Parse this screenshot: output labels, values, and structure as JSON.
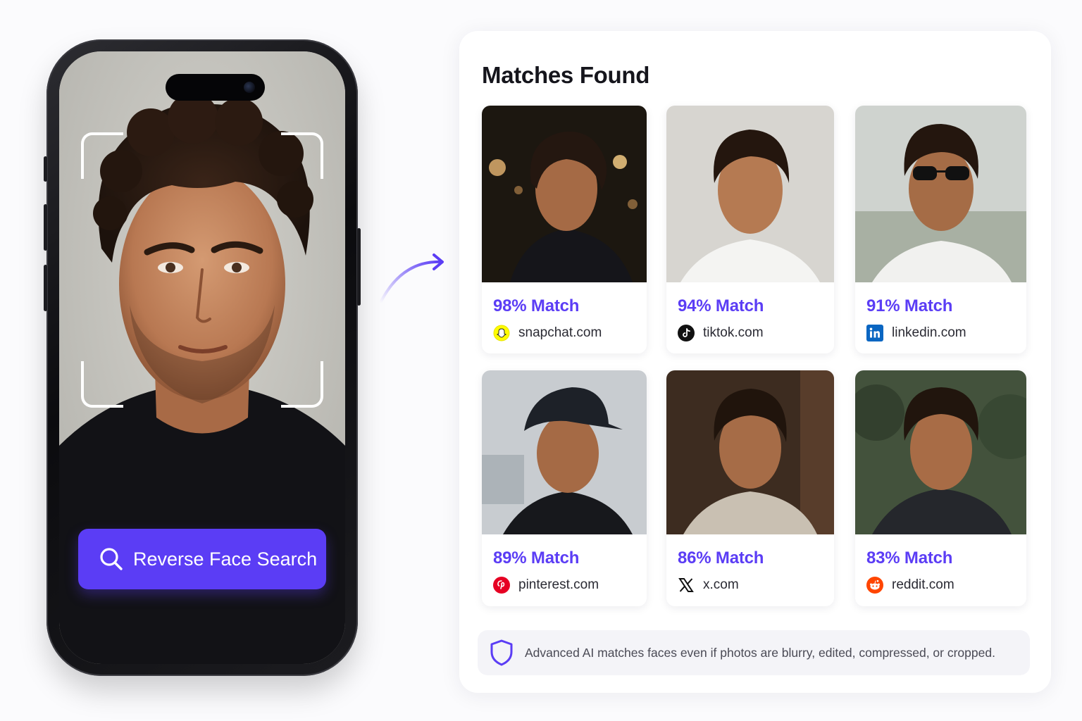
{
  "phone": {
    "search_button_label": "Reverse Face Search"
  },
  "results": {
    "title": "Matches Found",
    "matches": [
      {
        "percent": "98% Match",
        "domain": "snapchat.com",
        "icon": "snapchat-icon"
      },
      {
        "percent": "94% Match",
        "domain": "tiktok.com",
        "icon": "tiktok-icon"
      },
      {
        "percent": "91% Match",
        "domain": "linkedin.com",
        "icon": "linkedin-icon"
      },
      {
        "percent": "89% Match",
        "domain": "pinterest.com",
        "icon": "pinterest-icon"
      },
      {
        "percent": "86% Match",
        "domain": "x.com",
        "icon": "x-icon"
      },
      {
        "percent": "83% Match",
        "domain": "reddit.com",
        "icon": "reddit-icon"
      }
    ],
    "notice": "Advanced AI matches faces even if photos are blurry, edited, compressed, or cropped."
  },
  "colors": {
    "accent": "#5b3df5",
    "snapchat": "#fffc00",
    "linkedin": "#0a66c2",
    "pinterest": "#e60023",
    "reddit": "#ff4500"
  }
}
